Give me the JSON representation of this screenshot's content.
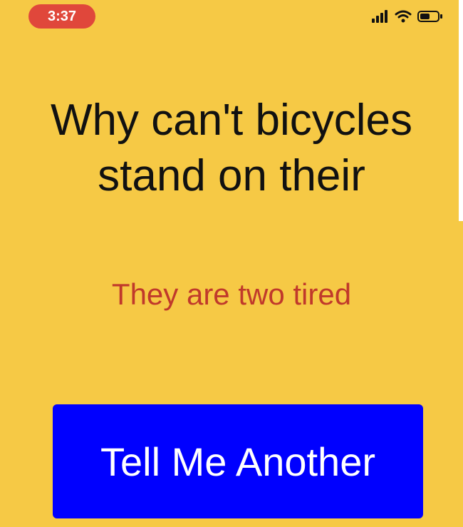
{
  "status_bar": {
    "time": "3:37",
    "icons": [
      "signal-icon",
      "wifi-icon",
      "battery-icon"
    ]
  },
  "joke": {
    "question": "Why can't bicycles stand on their",
    "answer": "They are two tired"
  },
  "actions": {
    "tell_another_label": "Tell Me Another"
  },
  "colors": {
    "background": "#f6c945",
    "answer_text": "#c0392b",
    "button": "#0000ff",
    "time_pill": "#e0473b"
  }
}
